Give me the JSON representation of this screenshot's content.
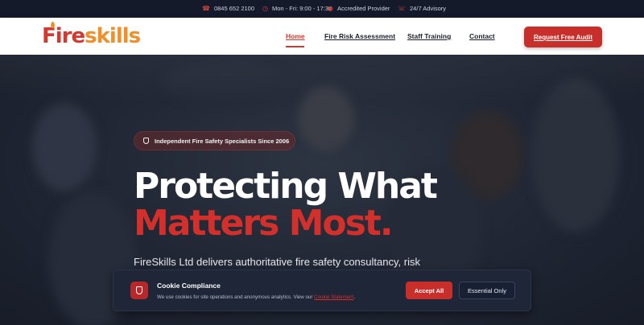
{
  "topbar": {
    "phone": "0845 652 2100",
    "hours": "Mon - Fri: 9:00 - 17:30",
    "accredited": "Accredited Provider",
    "advisory": "24/7 Advisory",
    "icons": [
      "phone-icon",
      "clock-icon",
      "award-icon",
      "headset-icon"
    ]
  },
  "header": {
    "logo_fire": "Fire",
    "logo_skills": "skills",
    "nav": [
      "Home",
      "Fire Risk Assessment",
      "Staff Training",
      "Contact"
    ],
    "active_nav": "Home",
    "cta": "Request Free Audit"
  },
  "hero": {
    "badge": "Independent Fire Safety Specialists Since 2006",
    "headline_1": "Protecting What",
    "headline_2": "Matters Most.",
    "lede": "FireSkills Ltd delivers authoritative fire safety consultancy, risk"
  },
  "cookie": {
    "title": "Cookie Compliance",
    "text": "We use cookies for site operations and anonymous analytics. View our",
    "link": "Cookie Statement",
    "text_end": ".",
    "accept": "Accept All",
    "essential": "Essential Only"
  },
  "colors": {
    "brand_red": "#d23a2f",
    "brand_orange": "#f0902a",
    "button_red": "#c82e2a",
    "topbar_bg": "#141a2a",
    "cookie_bg": "#1f2638"
  }
}
